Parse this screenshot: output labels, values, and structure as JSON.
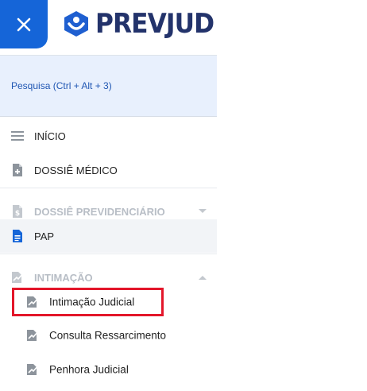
{
  "header": {
    "close_icon": "close-icon",
    "logo_text": "PREVJUD",
    "colors": {
      "accent": "#1565d8",
      "logo": "#23336b",
      "highlight": "#e3162a"
    }
  },
  "search": {
    "label": "Pesquisa (Ctrl + Alt + 3)"
  },
  "menu": {
    "items": [
      {
        "label": "INÍCIO",
        "icon": "menu-icon",
        "state": "normal"
      },
      {
        "label": "DOSSIÊ MÉDICO",
        "icon": "medical-document-icon",
        "state": "normal"
      },
      {
        "label": "DOSSIÊ PREVIDENCIÁRIO",
        "icon": "money-document-icon",
        "state": "disabled",
        "caret": "down"
      },
      {
        "label": "PAP",
        "icon": "document-icon",
        "state": "active"
      },
      {
        "label": "INTIMAÇÃO",
        "icon": "signature-icon",
        "state": "disabled",
        "caret": "up"
      }
    ],
    "sub_items": [
      {
        "label": "Intimação Judicial",
        "icon": "signature-icon",
        "highlighted": true
      },
      {
        "label": "Consulta Ressarcimento",
        "icon": "signature-icon"
      },
      {
        "label": "Penhora Judicial",
        "icon": "signature-icon"
      }
    ]
  }
}
